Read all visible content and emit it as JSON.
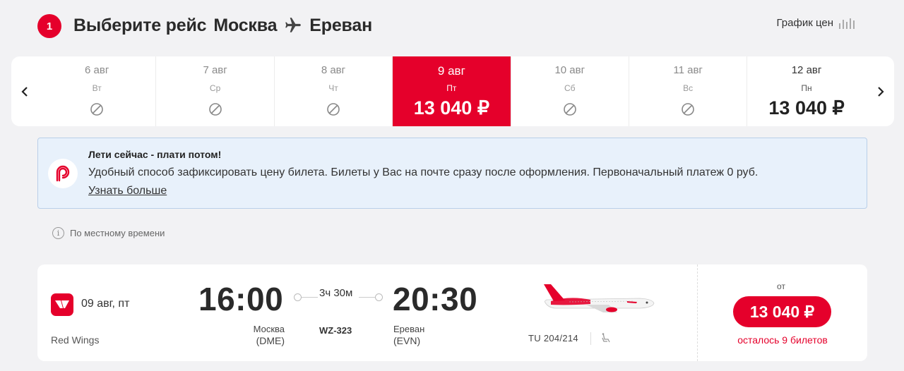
{
  "header": {
    "step": "1",
    "title_prefix": "Выберите рейс",
    "origin": "Москва",
    "destination": "Ереван",
    "price_chart_label": "График цен"
  },
  "date_strip": {
    "days": [
      {
        "date": "6 авг",
        "weekday": "Вт",
        "price": "",
        "available": false,
        "selected": false
      },
      {
        "date": "7 авг",
        "weekday": "Ср",
        "price": "",
        "available": false,
        "selected": false
      },
      {
        "date": "8 авг",
        "weekday": "Чт",
        "price": "",
        "available": false,
        "selected": false
      },
      {
        "date": "9 авг",
        "weekday": "Пт",
        "price": "13 040 ₽",
        "available": true,
        "selected": true
      },
      {
        "date": "10 авг",
        "weekday": "Сб",
        "price": "",
        "available": false,
        "selected": false
      },
      {
        "date": "11 авг",
        "weekday": "Вс",
        "price": "",
        "available": false,
        "selected": false
      },
      {
        "date": "12 авг",
        "weekday": "Пн",
        "price": "13 040 ₽",
        "available": true,
        "selected": false
      }
    ]
  },
  "banner": {
    "title": "Лети сейчас - плати потом!",
    "text": "Удобный способ зафиксировать цену билета. Билеты у Вас на почте сразу после оформления. Первоначальный платеж 0 руб.",
    "link": "Узнать больше"
  },
  "local_time_note": "По местному времени",
  "flight": {
    "date": "09 авг, пт",
    "airline": "Red Wings",
    "departure_time": "16:00",
    "arrival_time": "20:30",
    "duration": "3ч 30м",
    "flight_number": "WZ-323",
    "departure_city": "Москва",
    "departure_code": "(DME)",
    "arrival_city": "Ереван",
    "arrival_code": "(EVN)",
    "aircraft": "TU 204/214",
    "price_from": "от",
    "price": "13 040 ₽",
    "seats_left": "осталось 9 билетов"
  },
  "colors": {
    "accent": "#e5002b",
    "background": "#f2f2f4",
    "banner_bg": "#e8f1fb",
    "banner_border": "#b9cfe9"
  }
}
